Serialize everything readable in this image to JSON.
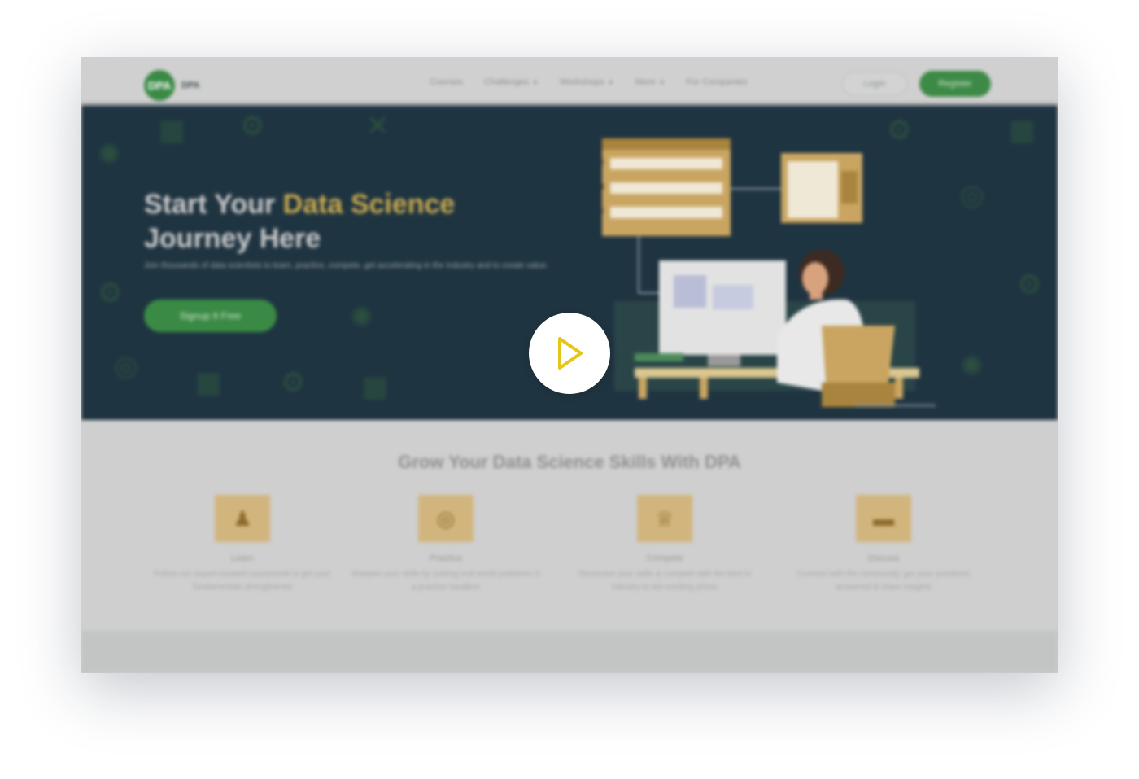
{
  "header": {
    "logo_mark": "DPA",
    "logo_text": "DPA",
    "nav": [
      {
        "label": "Courses",
        "dropdown": false
      },
      {
        "label": "Challenges",
        "dropdown": true
      },
      {
        "label": "Workshops",
        "dropdown": true
      },
      {
        "label": "More",
        "dropdown": true
      },
      {
        "label": "For Companies",
        "dropdown": false
      }
    ],
    "login_label": "Login",
    "register_label": "Register"
  },
  "hero": {
    "title_prefix": "Start Your ",
    "title_accent": "Data Science",
    "title_suffix": " Journey Here",
    "subtitle": "Join thousands of data scientists to learn, practice, compete, get accelerating in the industry and to create value.",
    "cta_label": "Signup It Free"
  },
  "features": {
    "title": "Grow Your Data Science Skills With DPA",
    "items": [
      {
        "name": "Learn",
        "icon": "learner-icon",
        "desc": "Follow our expert-curated coursework to get your fundamentals strengthened"
      },
      {
        "name": "Practice",
        "icon": "target-icon",
        "desc": "Sharpen your skills by solving real-world problems in a practice sandbox"
      },
      {
        "name": "Compete",
        "icon": "trophy-icon",
        "desc": "Showcase your skills & compete with the best in industry to win exciting prizes"
      },
      {
        "name": "Discuss",
        "icon": "chat-icon",
        "desc": "Connect with the community, get your questions answered & share insights"
      }
    ]
  },
  "colors": {
    "brand_green": "#3a8a45",
    "hero_bg": "#1f3441",
    "accent_gold": "#c9a94e",
    "play_icon": "#e6c619"
  },
  "overlay": {
    "play_icon": "play-icon"
  }
}
